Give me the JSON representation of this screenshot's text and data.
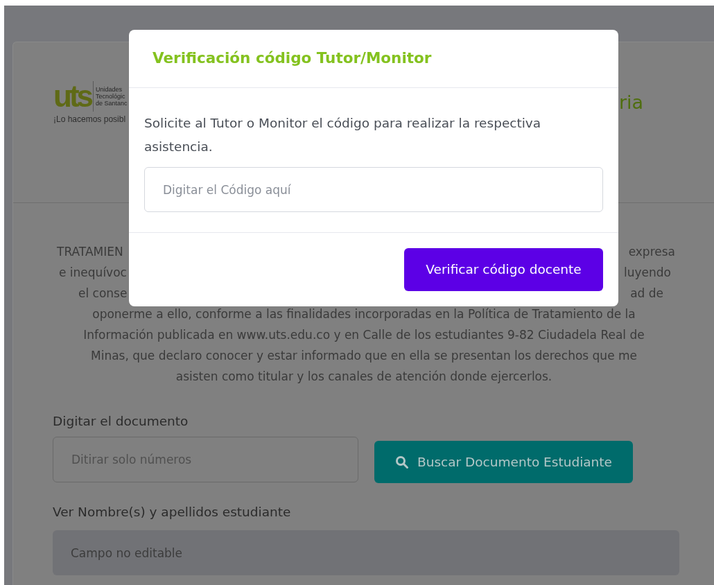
{
  "page": {
    "logo": {
      "mark": "uts",
      "name_lines": [
        "Unidades",
        "Tecnológic",
        "de Santanc"
      ],
      "slogan": "¡Lo hacemos posibl"
    },
    "title_fragment": "ria",
    "notice": {
      "partial_lines": [
        {
          "left": "TRATAMIEN",
          "right": "expresa"
        },
        {
          "left": "e inequívoc",
          "right": "luyendo"
        },
        {
          "left": "el conse",
          "right": "ad de"
        }
      ],
      "lines": [
        "oponerme a ello, conforme a las finalidades incorporadas en la Política de Tratamiento de la",
        "Información publicada en www.uts.edu.co y en Calle de los estudiantes 9-82 Ciudadela Real de",
        "Minas, que declaro conocer y estar informado que en ella se presentan los derechos que me",
        "asisten como titular y los canales de atención donde ejercerlos."
      ]
    },
    "document": {
      "label": "Digitar el documento",
      "placeholder": "Ditirar solo números"
    },
    "search_button": {
      "label": "Buscar Documento Estudiante"
    },
    "student_name": {
      "label": "Ver Nombre(s) y apellidos estudiante",
      "placeholder": "Campo no editable",
      "disabled": true
    }
  },
  "dialog": {
    "title": "Verificación código Tutor/Monitor",
    "message": "Solicite al Tutor o Monitor el código para realizar la respectiva asistencia.",
    "code_field": {
      "placeholder": "Digitar el Código aquí"
    },
    "verify_button": {
      "label": "Verificar código docente"
    }
  }
}
